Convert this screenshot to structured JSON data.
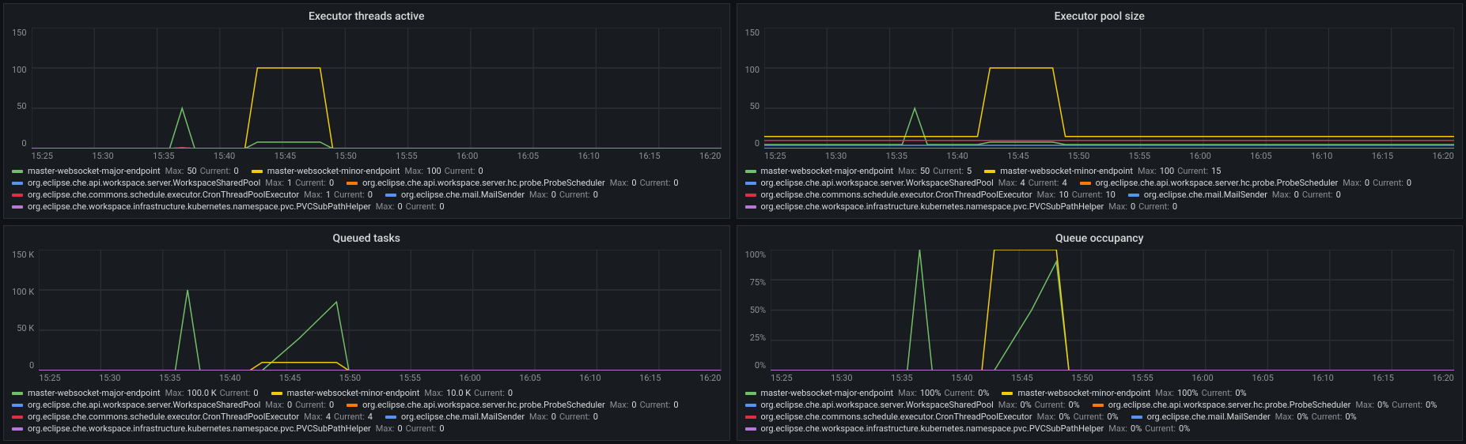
{
  "xticks": [
    "15:25",
    "15:30",
    "15:35",
    "15:40",
    "15:45",
    "15:50",
    "15:55",
    "16:00",
    "16:05",
    "16:10",
    "16:15",
    "16:20"
  ],
  "colors": {
    "green": "#73bf69",
    "yellow": "#f2cc0c",
    "cyan": "#5794f2",
    "orange": "#ff780a",
    "red": "#e02f44",
    "blue": "#5794f2",
    "purple": "#b877d9"
  },
  "panels": [
    {
      "title": "Executor threads active",
      "yticks": [
        "150",
        "100",
        "50",
        "0"
      ],
      "ylim": [
        0,
        150
      ],
      "series": [
        {
          "name": "master-websocket-major-endpoint",
          "color": "green",
          "max": "50",
          "current": "0"
        },
        {
          "name": "master-websocket-minor-endpoint",
          "color": "yellow",
          "max": "100",
          "current": "0"
        },
        {
          "name": "org.eclipse.che.api.workspace.server.WorkspaceSharedPool",
          "color": "cyan",
          "max": "1",
          "current": "0"
        },
        {
          "name": "org.eclipse.che.api.workspace.server.hc.probe.ProbeScheduler",
          "color": "orange",
          "max": "0",
          "current": "0"
        },
        {
          "name": "org.eclipse.che.commons.schedule.executor.CronThreadPoolExecutor",
          "color": "red",
          "max": "1",
          "current": "0"
        },
        {
          "name": "org.eclipse.che.mail.MailSender",
          "color": "blue",
          "max": "0",
          "current": "0"
        },
        {
          "name": "org.eclipse.che.workspace.infrastructure.kubernetes.namespace.pvc.PVCSubPathHelper",
          "color": "purple",
          "max": "0",
          "current": "0"
        }
      ]
    },
    {
      "title": "Executor pool size",
      "yticks": [
        "150",
        "100",
        "50",
        "0"
      ],
      "ylim": [
        0,
        150
      ],
      "series": [
        {
          "name": "master-websocket-major-endpoint",
          "color": "green",
          "max": "50",
          "current": "5"
        },
        {
          "name": "master-websocket-minor-endpoint",
          "color": "yellow",
          "max": "100",
          "current": "15"
        },
        {
          "name": "org.eclipse.che.api.workspace.server.WorkspaceSharedPool",
          "color": "cyan",
          "max": "4",
          "current": "4"
        },
        {
          "name": "org.eclipse.che.api.workspace.server.hc.probe.ProbeScheduler",
          "color": "orange",
          "max": "0",
          "current": "0"
        },
        {
          "name": "org.eclipse.che.commons.schedule.executor.CronThreadPoolExecutor",
          "color": "red",
          "max": "10",
          "current": "10"
        },
        {
          "name": "org.eclipse.che.mail.MailSender",
          "color": "blue",
          "max": "0",
          "current": "0"
        },
        {
          "name": "org.eclipse.che.workspace.infrastructure.kubernetes.namespace.pvc.PVCSubPathHelper",
          "color": "purple",
          "max": "0",
          "current": "0"
        }
      ]
    },
    {
      "title": "Queued tasks",
      "yticks": [
        "150 K",
        "100 K",
        "50 K",
        "0"
      ],
      "ylim": [
        0,
        150
      ],
      "series": [
        {
          "name": "master-websocket-major-endpoint",
          "color": "green",
          "max": "100.0 K",
          "current": "0"
        },
        {
          "name": "master-websocket-minor-endpoint",
          "color": "yellow",
          "max": "10.0 K",
          "current": "0"
        },
        {
          "name": "org.eclipse.che.api.workspace.server.WorkspaceSharedPool",
          "color": "cyan",
          "max": "0",
          "current": "0"
        },
        {
          "name": "org.eclipse.che.api.workspace.server.hc.probe.ProbeScheduler",
          "color": "orange",
          "max": "0",
          "current": "0"
        },
        {
          "name": "org.eclipse.che.commons.schedule.executor.CronThreadPoolExecutor",
          "color": "red",
          "max": "4",
          "current": "4"
        },
        {
          "name": "org.eclipse.che.mail.MailSender",
          "color": "blue",
          "max": "0",
          "current": "0"
        },
        {
          "name": "org.eclipse.che.workspace.infrastructure.kubernetes.namespace.pvc.PVCSubPathHelper",
          "color": "purple",
          "max": "0",
          "current": "0"
        }
      ]
    },
    {
      "title": "Queue occupancy",
      "yticks": [
        "100%",
        "75%",
        "50%",
        "25%",
        "0%"
      ],
      "ylim": [
        0,
        100
      ],
      "series": [
        {
          "name": "master-websocket-major-endpoint",
          "color": "green",
          "max": "100%",
          "current": "0%"
        },
        {
          "name": "master-websocket-minor-endpoint",
          "color": "yellow",
          "max": "100%",
          "current": "0%"
        },
        {
          "name": "org.eclipse.che.api.workspace.server.WorkspaceSharedPool",
          "color": "cyan",
          "max": "0%",
          "current": "0%"
        },
        {
          "name": "org.eclipse.che.api.workspace.server.hc.probe.ProbeScheduler",
          "color": "orange",
          "max": "0%",
          "current": "0%"
        },
        {
          "name": "org.eclipse.che.commons.schedule.executor.CronThreadPoolExecutor",
          "color": "red",
          "max": "0%",
          "current": "0%"
        },
        {
          "name": "org.eclipse.che.mail.MailSender",
          "color": "blue",
          "max": "0%",
          "current": "0%"
        },
        {
          "name": "org.eclipse.che.workspace.infrastructure.kubernetes.namespace.pvc.PVCSubPathHelper",
          "color": "purple",
          "max": "0%",
          "current": "0%"
        }
      ]
    }
  ],
  "stat_labels": {
    "max": "Max:",
    "current": "Current:"
  },
  "chart_data": [
    {
      "type": "line",
      "title": "Executor threads active",
      "xlabel": "",
      "ylabel": "",
      "ylim": [
        0,
        150
      ],
      "x": [
        "15:25",
        "15:30",
        "15:35",
        "15:36",
        "15:37",
        "15:38",
        "15:40",
        "15:42",
        "15:43",
        "15:48",
        "15:49",
        "15:55",
        "16:00",
        "16:20"
      ],
      "series": [
        {
          "name": "master-websocket-major-endpoint",
          "values": [
            0,
            0,
            0,
            0,
            50,
            0,
            0,
            0,
            8,
            8,
            0,
            0,
            0,
            0
          ]
        },
        {
          "name": "master-websocket-minor-endpoint",
          "values": [
            0,
            0,
            0,
            0,
            0,
            0,
            0,
            0,
            100,
            100,
            0,
            0,
            0,
            0
          ]
        },
        {
          "name": "org.eclipse.che.api.workspace.server.WorkspaceSharedPool",
          "values": [
            0,
            0,
            0,
            0,
            1,
            0,
            0,
            0,
            0,
            0,
            0,
            0,
            0,
            0
          ]
        },
        {
          "name": "org.eclipse.che.api.workspace.server.hc.probe.ProbeScheduler",
          "values": [
            0,
            0,
            0,
            0,
            0,
            0,
            0,
            0,
            0,
            0,
            0,
            0,
            0,
            0
          ]
        },
        {
          "name": "org.eclipse.che.commons.schedule.executor.CronThreadPoolExecutor",
          "values": [
            0,
            0,
            0,
            0,
            1,
            0,
            0,
            0,
            0,
            0,
            0,
            0,
            0,
            0
          ]
        },
        {
          "name": "org.eclipse.che.mail.MailSender",
          "values": [
            0,
            0,
            0,
            0,
            0,
            0,
            0,
            0,
            0,
            0,
            0,
            0,
            0,
            0
          ]
        },
        {
          "name": "org.eclipse.che.workspace.infrastructure.kubernetes.namespace.pvc.PVCSubPathHelper",
          "values": [
            0,
            0,
            0,
            0,
            0,
            0,
            0,
            0,
            0,
            0,
            0,
            0,
            0,
            0
          ]
        }
      ]
    },
    {
      "type": "line",
      "title": "Executor pool size",
      "xlabel": "",
      "ylabel": "",
      "ylim": [
        0,
        150
      ],
      "x": [
        "15:25",
        "15:30",
        "15:35",
        "15:36",
        "15:37",
        "15:38",
        "15:40",
        "15:42",
        "15:43",
        "15:48",
        "15:49",
        "15:55",
        "16:00",
        "16:20"
      ],
      "series": [
        {
          "name": "master-websocket-major-endpoint",
          "values": [
            5,
            5,
            5,
            5,
            50,
            5,
            5,
            5,
            8,
            8,
            5,
            5,
            5,
            5
          ]
        },
        {
          "name": "master-websocket-minor-endpoint",
          "values": [
            15,
            15,
            15,
            15,
            15,
            15,
            15,
            15,
            100,
            100,
            15,
            15,
            15,
            15
          ]
        },
        {
          "name": "org.eclipse.che.api.workspace.server.WorkspaceSharedPool",
          "values": [
            4,
            4,
            4,
            4,
            4,
            4,
            4,
            4,
            4,
            4,
            4,
            4,
            4,
            4
          ]
        },
        {
          "name": "org.eclipse.che.api.workspace.server.hc.probe.ProbeScheduler",
          "values": [
            0,
            0,
            0,
            0,
            0,
            0,
            0,
            0,
            0,
            0,
            0,
            0,
            0,
            0
          ]
        },
        {
          "name": "org.eclipse.che.commons.schedule.executor.CronThreadPoolExecutor",
          "values": [
            10,
            10,
            10,
            10,
            10,
            10,
            10,
            10,
            10,
            10,
            10,
            10,
            10,
            10
          ]
        },
        {
          "name": "org.eclipse.che.mail.MailSender",
          "values": [
            0,
            0,
            0,
            0,
            0,
            0,
            0,
            0,
            0,
            0,
            0,
            0,
            0,
            0
          ]
        },
        {
          "name": "org.eclipse.che.workspace.infrastructure.kubernetes.namespace.pvc.PVCSubPathHelper",
          "values": [
            0,
            0,
            0,
            0,
            0,
            0,
            0,
            0,
            0,
            0,
            0,
            0,
            0,
            0
          ]
        }
      ]
    },
    {
      "type": "line",
      "title": "Queued tasks",
      "xlabel": "",
      "ylabel": "",
      "ylim": [
        0,
        150000
      ],
      "x": [
        "15:25",
        "15:30",
        "15:35",
        "15:36",
        "15:37",
        "15:38",
        "15:40",
        "15:42",
        "15:43",
        "15:46",
        "15:49",
        "15:50",
        "15:55",
        "16:00",
        "16:20"
      ],
      "series": [
        {
          "name": "master-websocket-major-endpoint",
          "values": [
            0,
            0,
            0,
            0,
            100000,
            0,
            0,
            0,
            0,
            40000,
            85000,
            0,
            0,
            0,
            0
          ]
        },
        {
          "name": "master-websocket-minor-endpoint",
          "values": [
            0,
            0,
            0,
            0,
            0,
            0,
            0,
            0,
            10000,
            10000,
            10000,
            0,
            0,
            0,
            0
          ]
        },
        {
          "name": "org.eclipse.che.api.workspace.server.WorkspaceSharedPool",
          "values": [
            0,
            0,
            0,
            0,
            0,
            0,
            0,
            0,
            0,
            0,
            0,
            0,
            0,
            0,
            0
          ]
        },
        {
          "name": "org.eclipse.che.api.workspace.server.hc.probe.ProbeScheduler",
          "values": [
            0,
            0,
            0,
            0,
            0,
            0,
            0,
            0,
            0,
            0,
            0,
            0,
            0,
            0,
            0
          ]
        },
        {
          "name": "org.eclipse.che.commons.schedule.executor.CronThreadPoolExecutor",
          "values": [
            4,
            4,
            4,
            4,
            4,
            4,
            4,
            4,
            4,
            4,
            4,
            4,
            4,
            4,
            4
          ]
        },
        {
          "name": "org.eclipse.che.mail.MailSender",
          "values": [
            0,
            0,
            0,
            0,
            0,
            0,
            0,
            0,
            0,
            0,
            0,
            0,
            0,
            0,
            0
          ]
        },
        {
          "name": "org.eclipse.che.workspace.infrastructure.kubernetes.namespace.pvc.PVCSubPathHelper",
          "values": [
            0,
            0,
            0,
            0,
            0,
            0,
            0,
            0,
            0,
            0,
            0,
            0,
            0,
            0,
            0
          ]
        }
      ]
    },
    {
      "type": "line",
      "title": "Queue occupancy",
      "xlabel": "",
      "ylabel": "",
      "ylim": [
        0,
        100
      ],
      "x": [
        "15:25",
        "15:30",
        "15:35",
        "15:36",
        "15:37",
        "15:38",
        "15:40",
        "15:42",
        "15:43",
        "15:46",
        "15:48",
        "15:49",
        "15:55",
        "16:00",
        "16:20"
      ],
      "series": [
        {
          "name": "master-websocket-major-endpoint",
          "values": [
            0,
            0,
            0,
            0,
            100,
            0,
            0,
            0,
            0,
            50,
            90,
            0,
            0,
            0,
            0
          ]
        },
        {
          "name": "master-websocket-minor-endpoint",
          "values": [
            0,
            0,
            0,
            0,
            0,
            0,
            0,
            0,
            100,
            100,
            100,
            0,
            0,
            0,
            0
          ]
        },
        {
          "name": "org.eclipse.che.api.workspace.server.WorkspaceSharedPool",
          "values": [
            0,
            0,
            0,
            0,
            0,
            0,
            0,
            0,
            0,
            0,
            0,
            0,
            0,
            0,
            0
          ]
        },
        {
          "name": "org.eclipse.che.api.workspace.server.hc.probe.ProbeScheduler",
          "values": [
            0,
            0,
            0,
            0,
            0,
            0,
            0,
            0,
            0,
            0,
            0,
            0,
            0,
            0,
            0
          ]
        },
        {
          "name": "org.eclipse.che.commons.schedule.executor.CronThreadPoolExecutor",
          "values": [
            0,
            0,
            0,
            0,
            0,
            0,
            0,
            0,
            0,
            0,
            0,
            0,
            0,
            0,
            0
          ]
        },
        {
          "name": "org.eclipse.che.mail.MailSender",
          "values": [
            0,
            0,
            0,
            0,
            0,
            0,
            0,
            0,
            0,
            0,
            0,
            0,
            0,
            0,
            0
          ]
        },
        {
          "name": "org.eclipse.che.workspace.infrastructure.kubernetes.namespace.pvc.PVCSubPathHelper",
          "values": [
            0,
            0,
            0,
            0,
            0,
            0,
            0,
            0,
            0,
            0,
            0,
            0,
            0,
            0,
            0
          ]
        }
      ]
    }
  ]
}
